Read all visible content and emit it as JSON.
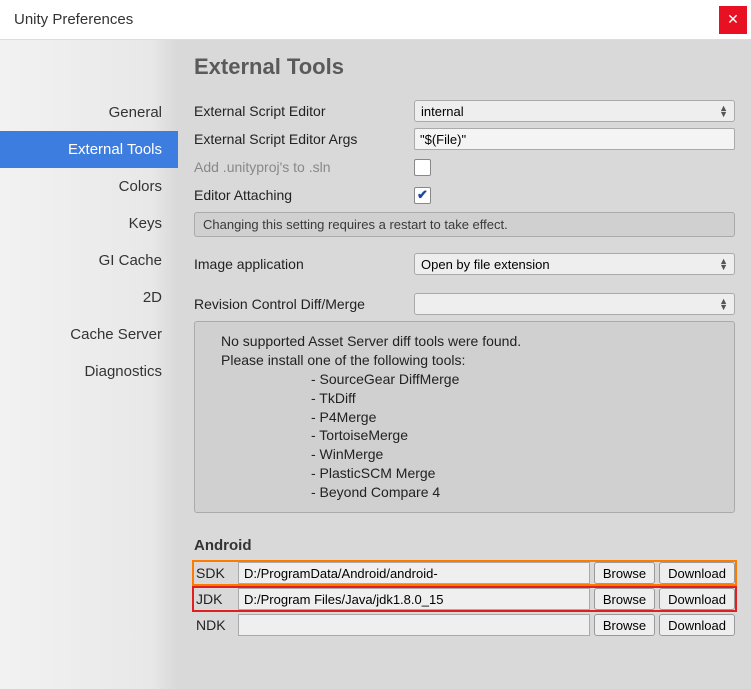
{
  "window": {
    "title": "Unity Preferences"
  },
  "sidebar": {
    "items": [
      {
        "label": "General"
      },
      {
        "label": "External Tools",
        "selected": true
      },
      {
        "label": "Colors"
      },
      {
        "label": "Keys"
      },
      {
        "label": "GI Cache"
      },
      {
        "label": "2D"
      },
      {
        "label": "Cache Server"
      },
      {
        "label": "Diagnostics"
      }
    ]
  },
  "page": {
    "title": "External Tools",
    "script_editor_label": "External Script Editor",
    "script_editor_value": "internal",
    "script_args_label": "External Script Editor Args",
    "script_args_value": "\"$(File)\"",
    "add_unityproj_label": "Add .unityproj's to .sln",
    "editor_attaching_label": "Editor Attaching",
    "restart_help": "Changing this setting requires a restart to take effect.",
    "image_app_label": "Image application",
    "image_app_value": "Open by file extension",
    "revision_label": "Revision Control Diff/Merge",
    "revision_value": "",
    "warn_line1": "No supported Asset Server diff tools were found.",
    "warn_line2": "Please install one of the following tools:",
    "warn_tools": [
      "- SourceGear DiffMerge",
      "- TkDiff",
      "- P4Merge",
      "- TortoiseMerge",
      "- WinMerge",
      "- PlasticSCM Merge",
      "- Beyond Compare 4"
    ],
    "android_title": "Android",
    "sdk_label": "SDK",
    "sdk_value": "D:/ProgramData/Android/android-",
    "jdk_label": "JDK",
    "jdk_value": "D:/Program Files/Java/jdk1.8.0_15",
    "ndk_label": "NDK",
    "ndk_value": "",
    "browse_label": "Browse",
    "download_label": "Download"
  }
}
